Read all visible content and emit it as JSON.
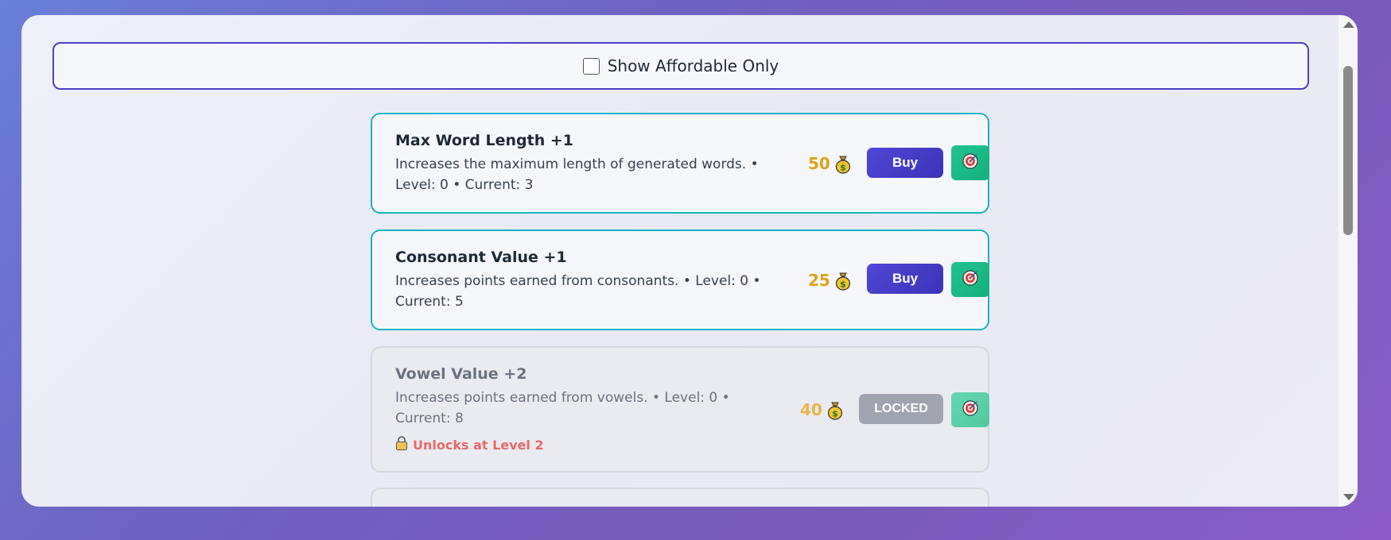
{
  "filter": {
    "label": "Show Affordable Only",
    "checked": false
  },
  "upgrades": [
    {
      "title": "Max Word Length +1",
      "description": "Increases the maximum length of generated words. • Level: 0 • Current: 3",
      "cost": "50",
      "button_label": "Buy",
      "state": "available"
    },
    {
      "title": "Consonant Value +1",
      "description": "Increases points earned from consonants. • Level: 0 • Current: 5",
      "cost": "25",
      "button_label": "Buy",
      "state": "available"
    },
    {
      "title": "Vowel Value +2",
      "description": "Increases points earned from vowels. • Level: 0 • Current: 8",
      "cost": "40",
      "button_label": "LOCKED",
      "lock_message": "Unlocks at Level 2",
      "state": "locked"
    }
  ],
  "icons": {
    "cost": "money-bag-icon",
    "target": "target-icon",
    "lock": "lock-icon"
  },
  "colors": {
    "accent": "#4b3fc9",
    "card_border": "#16b3c4",
    "cost": "#e0a21c",
    "buy_button": "#4a40cf",
    "target_button": "#1fbf8b",
    "locked_button": "#a0a4b0",
    "lock_text": "#e86a6a"
  }
}
